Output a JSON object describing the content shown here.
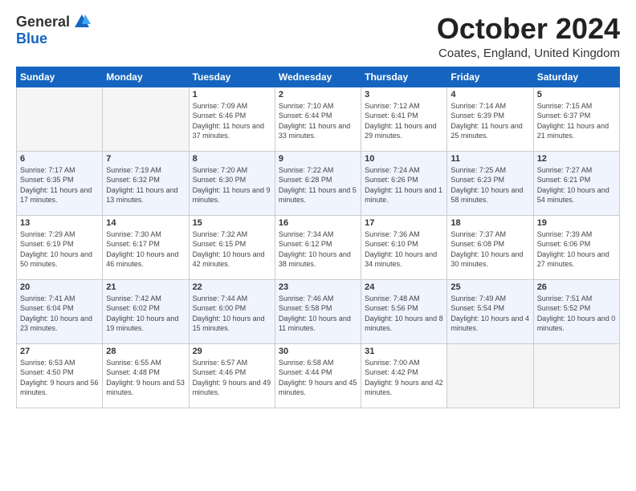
{
  "header": {
    "logo_general": "General",
    "logo_blue": "Blue",
    "month_title": "October 2024",
    "location": "Coates, England, United Kingdom"
  },
  "days_of_week": [
    "Sunday",
    "Monday",
    "Tuesday",
    "Wednesday",
    "Thursday",
    "Friday",
    "Saturday"
  ],
  "weeks": [
    [
      {
        "day": "",
        "sunrise": "",
        "sunset": "",
        "daylight": "",
        "empty": true
      },
      {
        "day": "",
        "sunrise": "",
        "sunset": "",
        "daylight": "",
        "empty": true
      },
      {
        "day": "1",
        "sunrise": "Sunrise: 7:09 AM",
        "sunset": "Sunset: 6:46 PM",
        "daylight": "Daylight: 11 hours and 37 minutes.",
        "empty": false
      },
      {
        "day": "2",
        "sunrise": "Sunrise: 7:10 AM",
        "sunset": "Sunset: 6:44 PM",
        "daylight": "Daylight: 11 hours and 33 minutes.",
        "empty": false
      },
      {
        "day": "3",
        "sunrise": "Sunrise: 7:12 AM",
        "sunset": "Sunset: 6:41 PM",
        "daylight": "Daylight: 11 hours and 29 minutes.",
        "empty": false
      },
      {
        "day": "4",
        "sunrise": "Sunrise: 7:14 AM",
        "sunset": "Sunset: 6:39 PM",
        "daylight": "Daylight: 11 hours and 25 minutes.",
        "empty": false
      },
      {
        "day": "5",
        "sunrise": "Sunrise: 7:15 AM",
        "sunset": "Sunset: 6:37 PM",
        "daylight": "Daylight: 11 hours and 21 minutes.",
        "empty": false
      }
    ],
    [
      {
        "day": "6",
        "sunrise": "Sunrise: 7:17 AM",
        "sunset": "Sunset: 6:35 PM",
        "daylight": "Daylight: 11 hours and 17 minutes.",
        "empty": false
      },
      {
        "day": "7",
        "sunrise": "Sunrise: 7:19 AM",
        "sunset": "Sunset: 6:32 PM",
        "daylight": "Daylight: 11 hours and 13 minutes.",
        "empty": false
      },
      {
        "day": "8",
        "sunrise": "Sunrise: 7:20 AM",
        "sunset": "Sunset: 6:30 PM",
        "daylight": "Daylight: 11 hours and 9 minutes.",
        "empty": false
      },
      {
        "day": "9",
        "sunrise": "Sunrise: 7:22 AM",
        "sunset": "Sunset: 6:28 PM",
        "daylight": "Daylight: 11 hours and 5 minutes.",
        "empty": false
      },
      {
        "day": "10",
        "sunrise": "Sunrise: 7:24 AM",
        "sunset": "Sunset: 6:26 PM",
        "daylight": "Daylight: 11 hours and 1 minute.",
        "empty": false
      },
      {
        "day": "11",
        "sunrise": "Sunrise: 7:25 AM",
        "sunset": "Sunset: 6:23 PM",
        "daylight": "Daylight: 10 hours and 58 minutes.",
        "empty": false
      },
      {
        "day": "12",
        "sunrise": "Sunrise: 7:27 AM",
        "sunset": "Sunset: 6:21 PM",
        "daylight": "Daylight: 10 hours and 54 minutes.",
        "empty": false
      }
    ],
    [
      {
        "day": "13",
        "sunrise": "Sunrise: 7:29 AM",
        "sunset": "Sunset: 6:19 PM",
        "daylight": "Daylight: 10 hours and 50 minutes.",
        "empty": false
      },
      {
        "day": "14",
        "sunrise": "Sunrise: 7:30 AM",
        "sunset": "Sunset: 6:17 PM",
        "daylight": "Daylight: 10 hours and 46 minutes.",
        "empty": false
      },
      {
        "day": "15",
        "sunrise": "Sunrise: 7:32 AM",
        "sunset": "Sunset: 6:15 PM",
        "daylight": "Daylight: 10 hours and 42 minutes.",
        "empty": false
      },
      {
        "day": "16",
        "sunrise": "Sunrise: 7:34 AM",
        "sunset": "Sunset: 6:12 PM",
        "daylight": "Daylight: 10 hours and 38 minutes.",
        "empty": false
      },
      {
        "day": "17",
        "sunrise": "Sunrise: 7:36 AM",
        "sunset": "Sunset: 6:10 PM",
        "daylight": "Daylight: 10 hours and 34 minutes.",
        "empty": false
      },
      {
        "day": "18",
        "sunrise": "Sunrise: 7:37 AM",
        "sunset": "Sunset: 6:08 PM",
        "daylight": "Daylight: 10 hours and 30 minutes.",
        "empty": false
      },
      {
        "day": "19",
        "sunrise": "Sunrise: 7:39 AM",
        "sunset": "Sunset: 6:06 PM",
        "daylight": "Daylight: 10 hours and 27 minutes.",
        "empty": false
      }
    ],
    [
      {
        "day": "20",
        "sunrise": "Sunrise: 7:41 AM",
        "sunset": "Sunset: 6:04 PM",
        "daylight": "Daylight: 10 hours and 23 minutes.",
        "empty": false
      },
      {
        "day": "21",
        "sunrise": "Sunrise: 7:42 AM",
        "sunset": "Sunset: 6:02 PM",
        "daylight": "Daylight: 10 hours and 19 minutes.",
        "empty": false
      },
      {
        "day": "22",
        "sunrise": "Sunrise: 7:44 AM",
        "sunset": "Sunset: 6:00 PM",
        "daylight": "Daylight: 10 hours and 15 minutes.",
        "empty": false
      },
      {
        "day": "23",
        "sunrise": "Sunrise: 7:46 AM",
        "sunset": "Sunset: 5:58 PM",
        "daylight": "Daylight: 10 hours and 11 minutes.",
        "empty": false
      },
      {
        "day": "24",
        "sunrise": "Sunrise: 7:48 AM",
        "sunset": "Sunset: 5:56 PM",
        "daylight": "Daylight: 10 hours and 8 minutes.",
        "empty": false
      },
      {
        "day": "25",
        "sunrise": "Sunrise: 7:49 AM",
        "sunset": "Sunset: 5:54 PM",
        "daylight": "Daylight: 10 hours and 4 minutes.",
        "empty": false
      },
      {
        "day": "26",
        "sunrise": "Sunrise: 7:51 AM",
        "sunset": "Sunset: 5:52 PM",
        "daylight": "Daylight: 10 hours and 0 minutes.",
        "empty": false
      }
    ],
    [
      {
        "day": "27",
        "sunrise": "Sunrise: 6:53 AM",
        "sunset": "Sunset: 4:50 PM",
        "daylight": "Daylight: 9 hours and 56 minutes.",
        "empty": false
      },
      {
        "day": "28",
        "sunrise": "Sunrise: 6:55 AM",
        "sunset": "Sunset: 4:48 PM",
        "daylight": "Daylight: 9 hours and 53 minutes.",
        "empty": false
      },
      {
        "day": "29",
        "sunrise": "Sunrise: 6:57 AM",
        "sunset": "Sunset: 4:46 PM",
        "daylight": "Daylight: 9 hours and 49 minutes.",
        "empty": false
      },
      {
        "day": "30",
        "sunrise": "Sunrise: 6:58 AM",
        "sunset": "Sunset: 4:44 PM",
        "daylight": "Daylight: 9 hours and 45 minutes.",
        "empty": false
      },
      {
        "day": "31",
        "sunrise": "Sunrise: 7:00 AM",
        "sunset": "Sunset: 4:42 PM",
        "daylight": "Daylight: 9 hours and 42 minutes.",
        "empty": false
      },
      {
        "day": "",
        "sunrise": "",
        "sunset": "",
        "daylight": "",
        "empty": true
      },
      {
        "day": "",
        "sunrise": "",
        "sunset": "",
        "daylight": "",
        "empty": true
      }
    ]
  ]
}
